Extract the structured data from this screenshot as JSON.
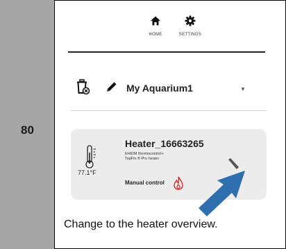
{
  "step": {
    "number": "80"
  },
  "nav": {
    "tabs": [
      {
        "label": "HOME",
        "icon": "home-icon"
      },
      {
        "label": "SETTINGS",
        "icon": "gear-icon"
      }
    ]
  },
  "aquarium": {
    "name": "My Aquarium1",
    "icons": [
      "trash-icon",
      "pencil-icon",
      "chevron-down-icon"
    ]
  },
  "heater": {
    "name": "Heater_16663265",
    "model_line1": "EHEIM thermocontrol+",
    "model_line2": "TopFin ® Pro heater",
    "temperature": "77.1°F",
    "mode": "Manual control",
    "icons": [
      "thermometer-icon",
      "flame-icon",
      "edit-icon"
    ]
  },
  "caption": "Change to the heater overview.",
  "colors": {
    "step_column": "#a6a6a6",
    "card_bg": "#ececec",
    "flame": "#e0242a",
    "arrow": "#2f6fae"
  }
}
